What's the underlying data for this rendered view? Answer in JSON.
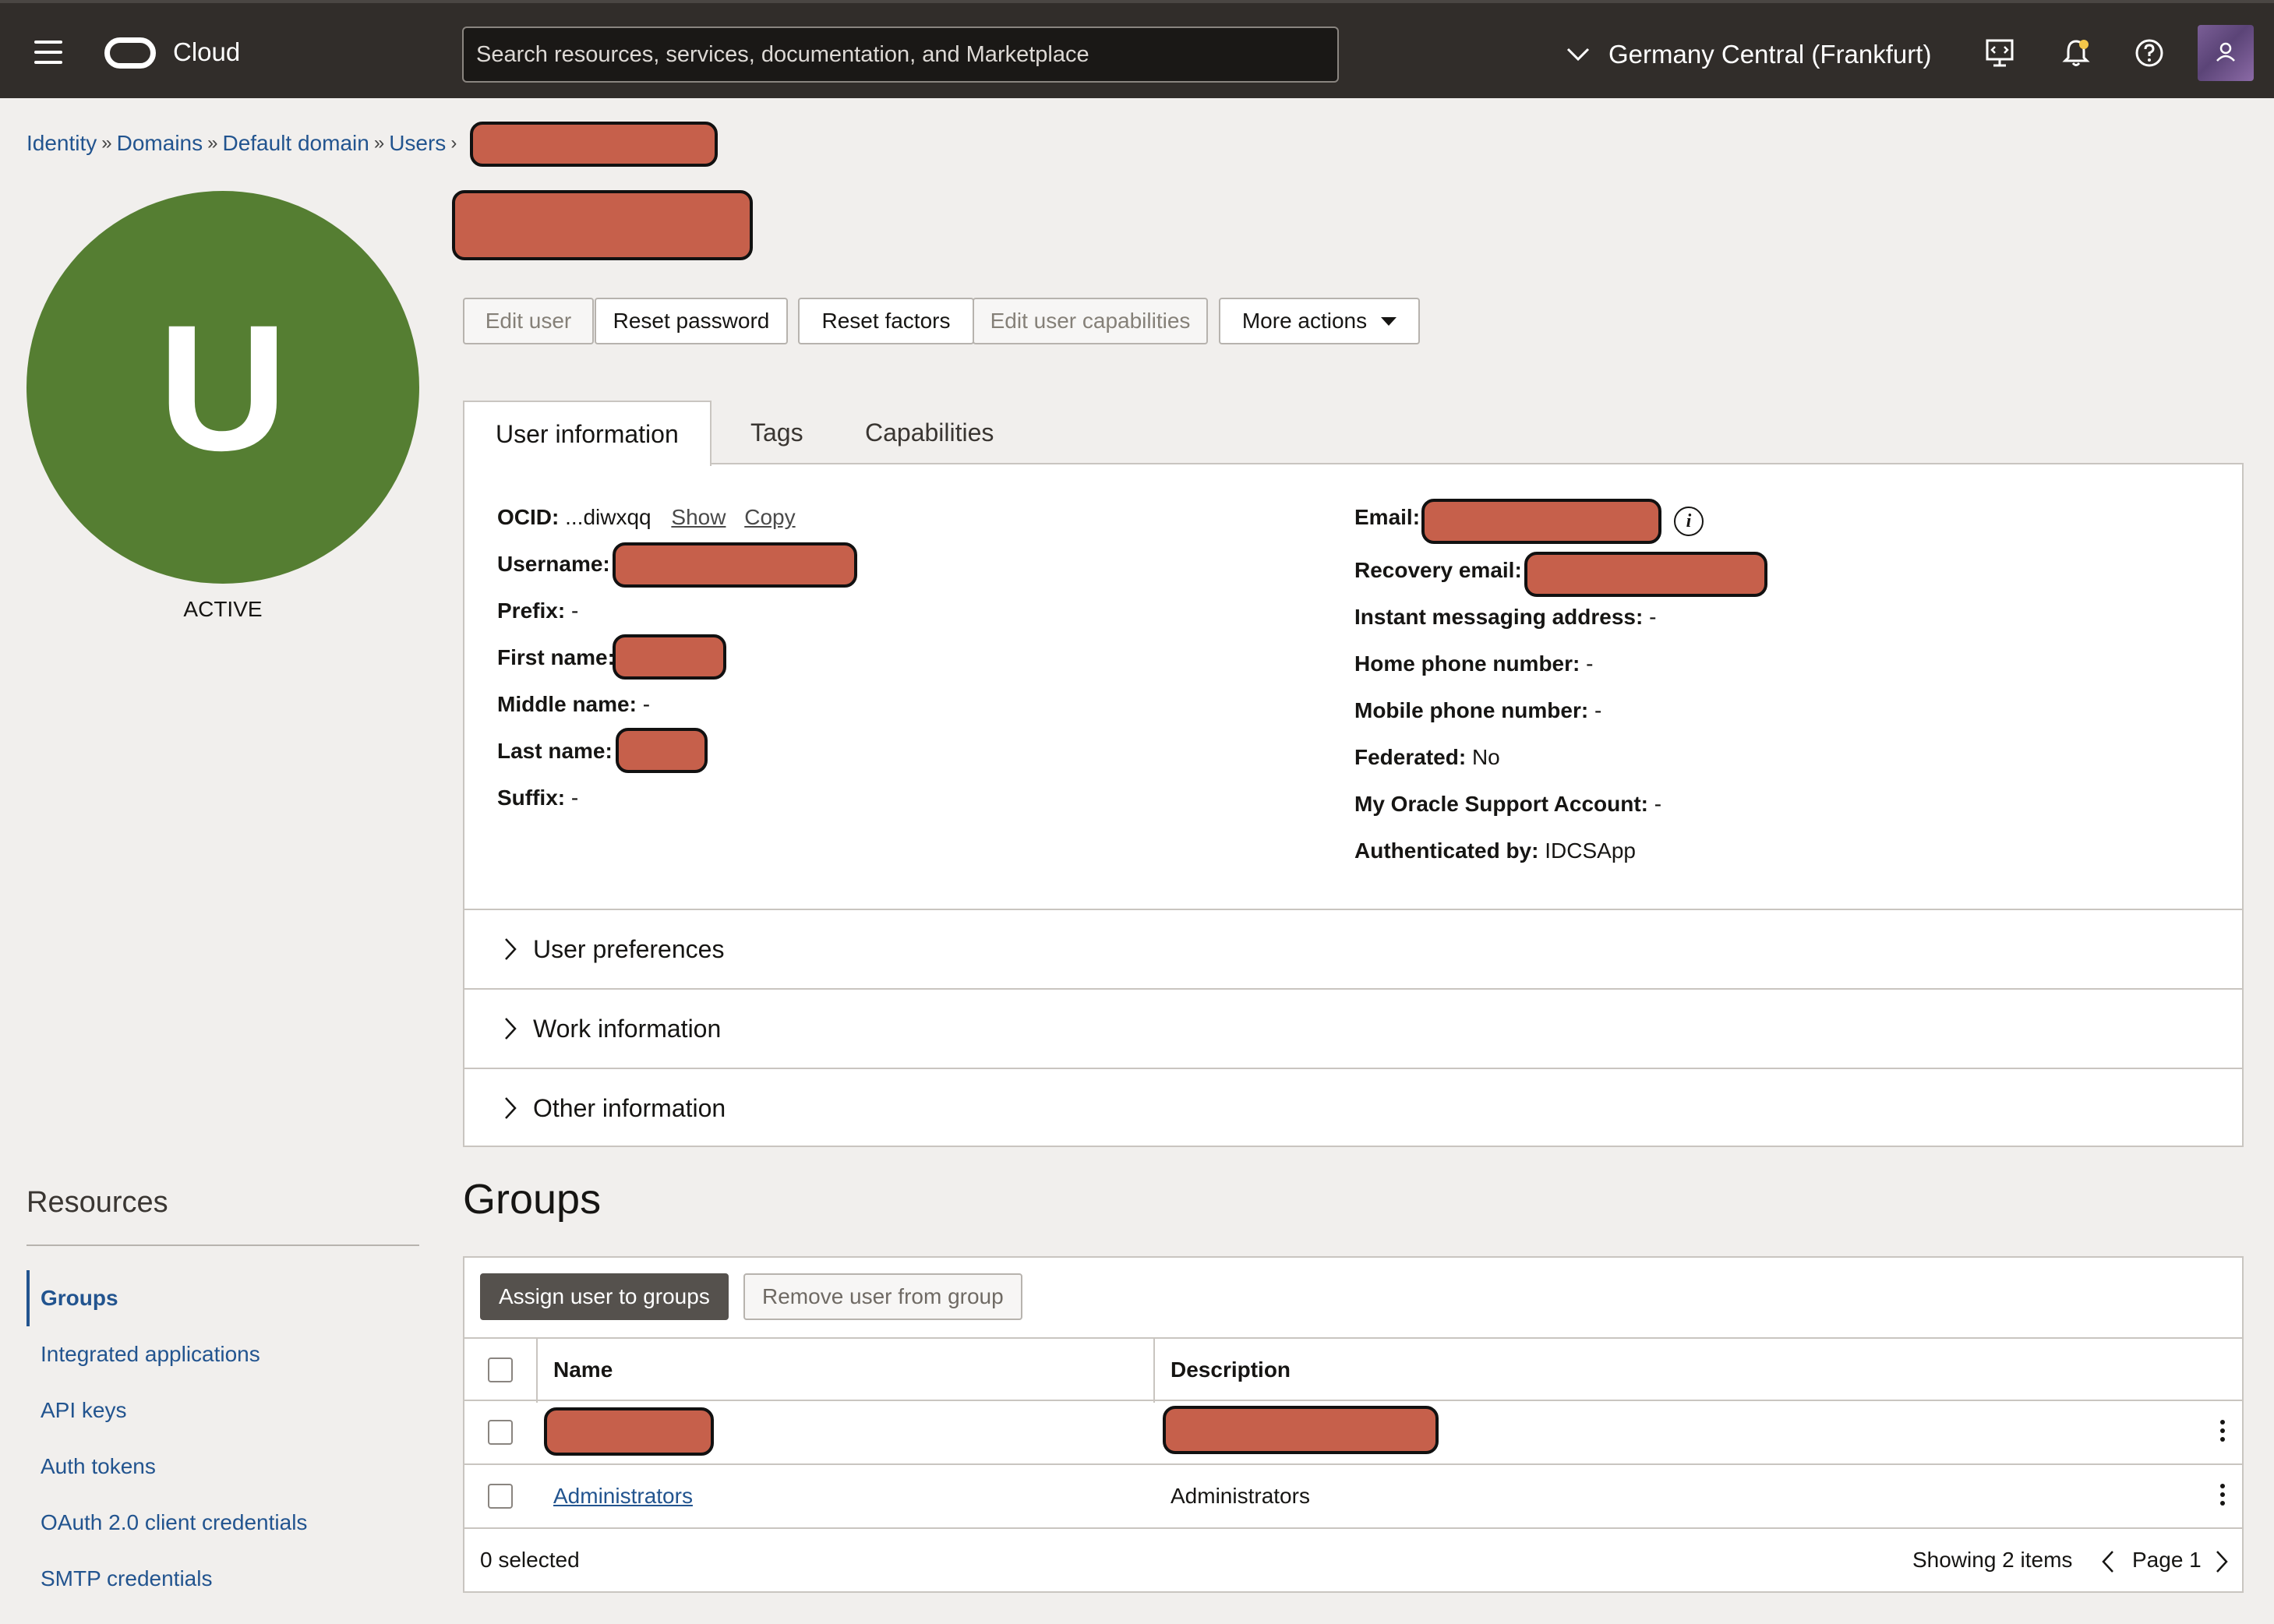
{
  "header": {
    "brand": "Cloud",
    "search_placeholder": "Search resources, services, documentation, and Marketplace",
    "region": "Germany Central (Frankfurt)"
  },
  "breadcrumb": [
    "Identity",
    "Domains",
    "Default domain",
    "Users"
  ],
  "user": {
    "avatar_letter": "U",
    "status": "ACTIVE"
  },
  "actions": {
    "edit_user": "Edit user",
    "reset_password": "Reset password",
    "reset_factors": "Reset factors",
    "edit_capabilities": "Edit user capabilities",
    "more_actions": "More actions"
  },
  "tabs": [
    "User information",
    "Tags",
    "Capabilities"
  ],
  "user_info": {
    "ocid_label": "OCID:",
    "ocid_value": "...diwxqq",
    "show_link": "Show",
    "copy_link": "Copy",
    "username_label": "Username:",
    "prefix_label": "Prefix:",
    "prefix_value": "-",
    "first_name_label": "First name:",
    "middle_name_label": "Middle name:",
    "middle_name_value": "-",
    "last_name_label": "Last name:",
    "suffix_label": "Suffix:",
    "suffix_value": "-",
    "email_label": "Email:",
    "recovery_email_label": "Recovery email:",
    "im_label": "Instant messaging address:",
    "im_value": "-",
    "home_phone_label": "Home phone number:",
    "home_phone_value": "-",
    "mobile_phone_label": "Mobile phone number:",
    "mobile_phone_value": "-",
    "federated_label": "Federated:",
    "federated_value": "No",
    "mos_label": "My Oracle Support Account:",
    "mos_value": "-",
    "auth_label": "Authenticated by:",
    "auth_value": "IDCSApp"
  },
  "sections": [
    "User preferences",
    "Work information",
    "Other information"
  ],
  "resources": {
    "heading": "Resources",
    "items": [
      "Groups",
      "Integrated applications",
      "API keys",
      "Auth tokens",
      "OAuth 2.0 client credentials",
      "SMTP credentials"
    ]
  },
  "groups": {
    "heading": "Groups",
    "assign_button": "Assign user to groups",
    "remove_button": "Remove user from group",
    "columns": [
      "Name",
      "Description"
    ],
    "rows": [
      {
        "name": "",
        "description": ""
      },
      {
        "name": "Administrators",
        "description": "Administrators"
      }
    ],
    "selected_text": "0 selected",
    "showing_text": "Showing 2 items",
    "page_text": "Page 1"
  },
  "colors": {
    "topbar": "#312d2a",
    "avatar_green": "#557e32",
    "link_blue": "#22548f",
    "redaction": "#c6604b"
  }
}
